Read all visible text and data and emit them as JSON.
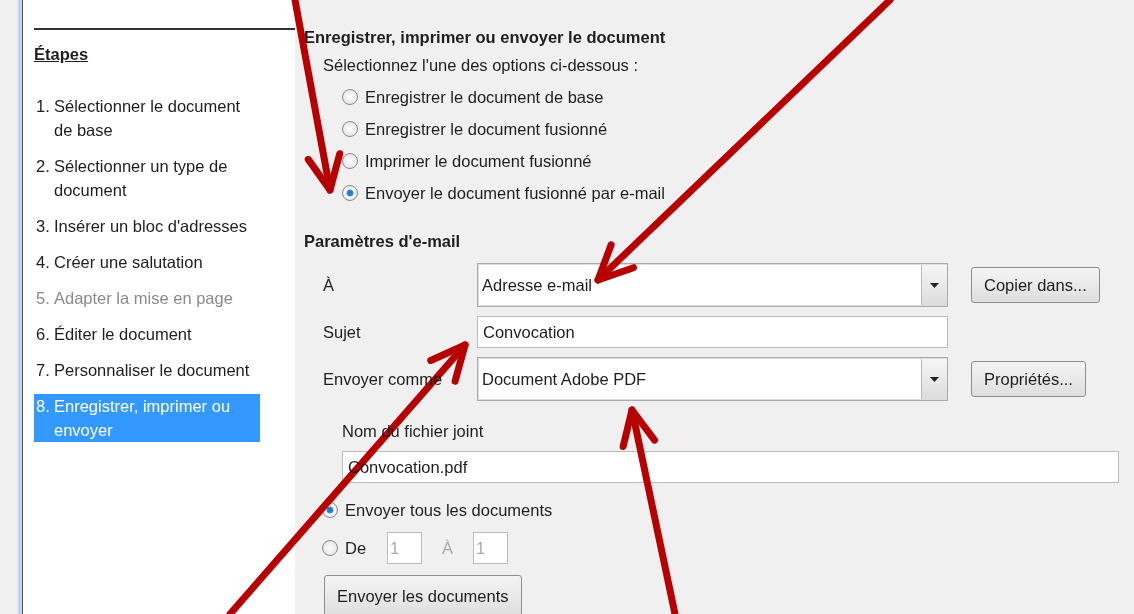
{
  "steps": {
    "title": "Étapes",
    "items": [
      {
        "number": "1.",
        "label": "Sélectionner le document de base",
        "selected": false,
        "disabled": false
      },
      {
        "number": "2.",
        "label": "Sélectionner un type de document",
        "selected": false,
        "disabled": false
      },
      {
        "number": "3.",
        "label": "Insérer un bloc d'adresses",
        "selected": false,
        "disabled": false
      },
      {
        "number": "4.",
        "label": "Créer une salutation",
        "selected": false,
        "disabled": false
      },
      {
        "number": "5.",
        "label": "Adapter la mise en page",
        "selected": false,
        "disabled": true
      },
      {
        "number": "6.",
        "label": "Éditer le document",
        "selected": false,
        "disabled": false
      },
      {
        "number": "7.",
        "label": "Personnaliser le document",
        "selected": false,
        "disabled": false
      },
      {
        "number": "8.",
        "label": "Enregistrer, imprimer ou envoyer",
        "selected": true,
        "disabled": false
      }
    ]
  },
  "section": {
    "title": "Enregistrer, imprimer ou envoyer le document",
    "instruction": "Sélectionnez l'une des options ci-dessous :",
    "options": [
      {
        "label": "Enregistrer le document de base",
        "selected": false
      },
      {
        "label": "Enregistrer le document fusionné",
        "selected": false
      },
      {
        "label": "Imprimer le document fusionné",
        "selected": false
      },
      {
        "label": "Envoyer le document fusionné par e-mail",
        "selected": true
      }
    ]
  },
  "email": {
    "title": "Paramètres d'e-mail",
    "to": {
      "label": "À",
      "value": "Adresse e-mail"
    },
    "copy_button": "Copier dans...",
    "subject": {
      "label": "Sujet",
      "value": "Convocation"
    },
    "send_as": {
      "label": "Envoyer comme",
      "value": "Document Adobe PDF"
    },
    "properties_button": "Propriétés...",
    "attachment": {
      "label": "Nom du fichier joint",
      "value": "Convocation.pdf"
    },
    "range_options": [
      {
        "kind": "all",
        "label": "Envoyer tous les documents",
        "selected": true
      },
      {
        "kind": "range",
        "label": "De",
        "selected": false
      }
    ],
    "range": {
      "disabled": true,
      "from": "1",
      "to_label": "À",
      "to": "1"
    },
    "send_button": "Envoyer les documents"
  }
}
